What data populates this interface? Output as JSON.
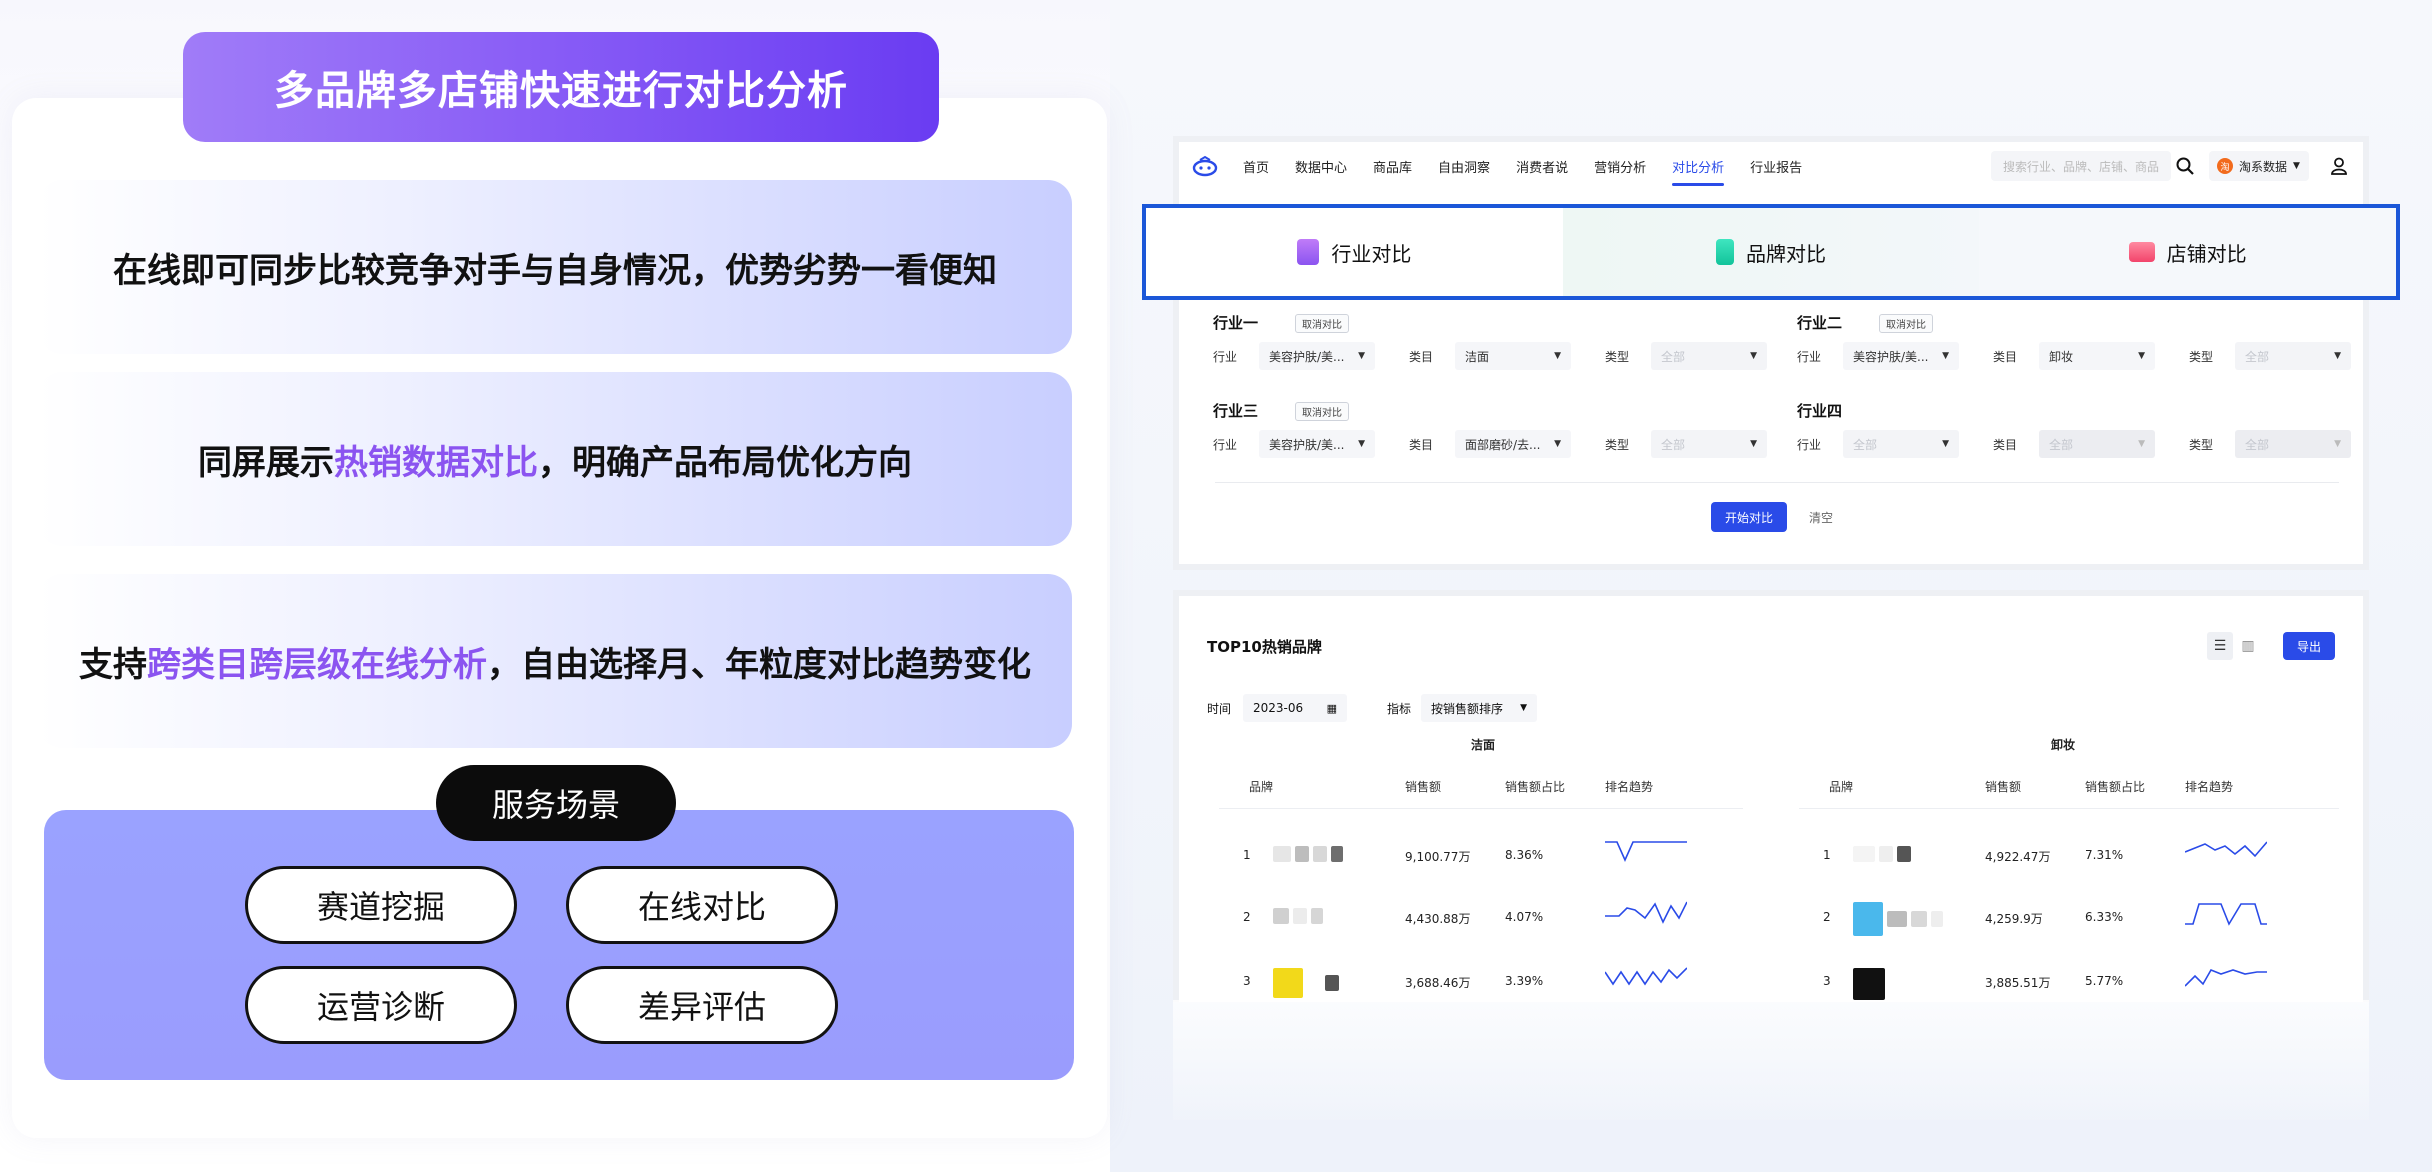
{
  "left": {
    "banner_title": "多品牌多店铺快速进行对比分析",
    "feature1": {
      "text": "在线即可同步比较竞争对手与自身情况，优势劣势一看便知"
    },
    "feature2": {
      "pre": "同屏展示",
      "highlight": "热销数据对比",
      "post": "，明确产品布局优化方向"
    },
    "feature3": {
      "pre": "支持",
      "highlight": "跨类目跨层级在线分析",
      "post": "，自由选择月、年粒度对比趋势变化"
    },
    "service_title": "服务场景",
    "services": [
      "赛道挖掘",
      "在线对比",
      "运营诊断",
      "差异评估"
    ],
    "colors": {
      "accent": "#8b54f0",
      "banner": "#7b4cf4",
      "service_bg": "#9aa0fe"
    }
  },
  "app": {
    "nav": [
      "首页",
      "数据中心",
      "商品库",
      "自由洞察",
      "消费者说",
      "营销分析",
      "对比分析",
      "行业报告"
    ],
    "nav_active": "对比分析",
    "search_placeholder": "搜索行业、品牌、店铺、商品",
    "brand_selector": "淘系数据",
    "brand_badge": "淘",
    "tabs": [
      "行业对比",
      "品牌对比",
      "店铺对比"
    ],
    "groups": [
      {
        "title": "行业一",
        "cancel": "取消对比",
        "industry": "美容护肤/美...",
        "category": "洁面",
        "type": "全部"
      },
      {
        "title": "行业二",
        "cancel": "取消对比",
        "industry": "美容护肤/美...",
        "category": "卸妆",
        "type": "全部"
      },
      {
        "title": "行业三",
        "cancel": "取消对比",
        "industry": "美容护肤/美...",
        "category": "面部磨砂/去...",
        "type": "全部"
      },
      {
        "title": "行业四",
        "cancel": "",
        "industry": "全部",
        "category": "全部",
        "type": "全部"
      }
    ],
    "labels": {
      "industry": "行业",
      "category": "类目",
      "type": "类型"
    },
    "start_button": "开始对比",
    "clear_button": "清空",
    "top10": {
      "title": "TOP10热销品牌",
      "export": "导出",
      "time_label": "时间",
      "time_value": "2023-06",
      "metric_label": "指标",
      "metric_value": "按销售额排序",
      "headers": [
        "品牌",
        "销售额",
        "销售额占比",
        "排名趋势"
      ],
      "left_category": "洁面",
      "right_category": "卸妆",
      "left_rows": [
        {
          "rank": "1",
          "sales": "9,100.77万",
          "share": "8.36%"
        },
        {
          "rank": "2",
          "sales": "4,430.88万",
          "share": "4.07%"
        },
        {
          "rank": "3",
          "sales": "3,688.46万",
          "share": "3.39%"
        }
      ],
      "right_rows": [
        {
          "rank": "1",
          "sales": "4,922.47万",
          "share": "7.31%"
        },
        {
          "rank": "2",
          "sales": "4,259.9万",
          "share": "6.33%"
        },
        {
          "rank": "3",
          "sales": "3,885.51万",
          "share": "5.77%"
        }
      ]
    }
  }
}
